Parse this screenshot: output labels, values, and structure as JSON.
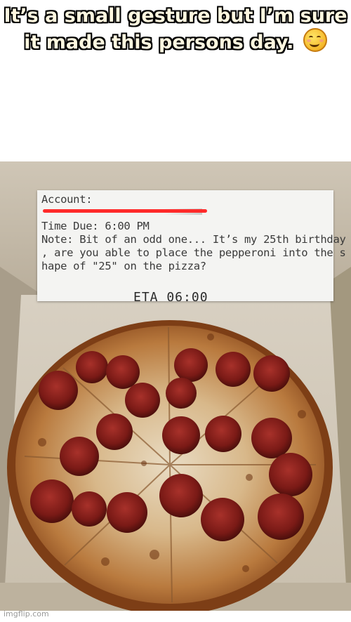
{
  "caption": {
    "text": "It’s a small gesture but I’m sure it made this persons day.",
    "emoji": "smiling-face-icon"
  },
  "receipt": {
    "lines": [
      "Account:",
      "",
      "Time Due: 6:00 PM",
      "Note: Bit of an odd one... It’s my 25th birthday",
      ", are you able to place the pepperoni into the s",
      "hape of \"25\" on the pizza?"
    ],
    "eta": "ETA 06:00",
    "redaction_color": "#ff2a2a"
  },
  "watermark": "imgflip.com"
}
